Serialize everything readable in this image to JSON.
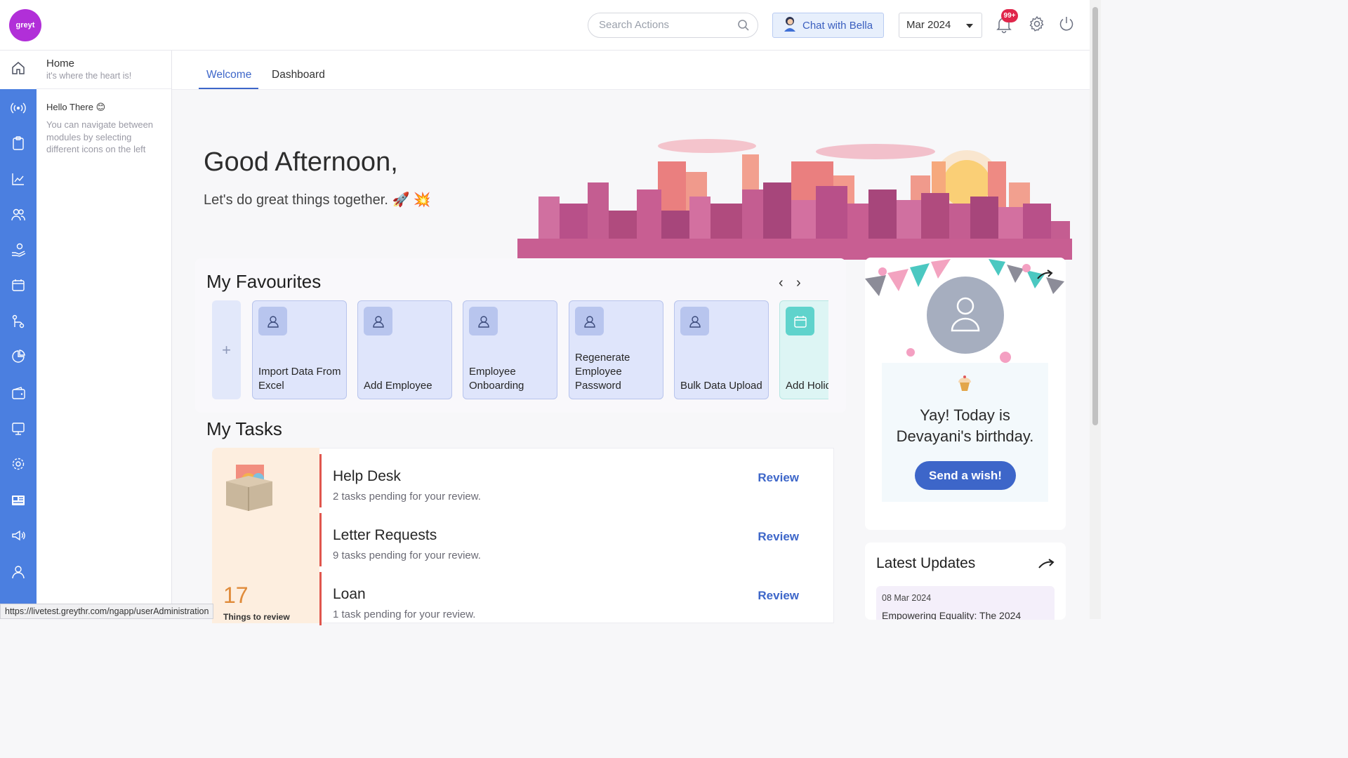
{
  "header": {
    "logo_text": "greyt",
    "search_placeholder": "Search Actions",
    "chat_label": "Chat with Bella",
    "month": "Mar 2024",
    "notification_badge": "99+"
  },
  "subpanel": {
    "title": "Home",
    "subtitle": "it's where the heart is!",
    "hello": "Hello There 😊",
    "hint": "You can navigate between modules by selecting different icons on the left"
  },
  "tabs": [
    {
      "label": "Welcome",
      "active": true
    },
    {
      "label": "Dashboard",
      "active": false
    }
  ],
  "greeting": {
    "title": "Good Afternoon,",
    "subtitle": "Let's do great things together. 🚀 💥"
  },
  "favourites": {
    "title": "My Favourites",
    "add_symbol": "+",
    "items": [
      {
        "label": "Import Data From Excel",
        "icon": "user-icon"
      },
      {
        "label": "Add Employee",
        "icon": "user-icon"
      },
      {
        "label": "Employee Onboarding",
        "icon": "user-icon"
      },
      {
        "label": "Regenerate Employee Password",
        "icon": "user-icon"
      },
      {
        "label": "Bulk Data Upload",
        "icon": "user-icon"
      },
      {
        "label": "Add Holid",
        "icon": "calendar-icon"
      }
    ]
  },
  "tasks": {
    "title": "My Tasks",
    "count": "17",
    "count_label": "Things to review",
    "items": [
      {
        "title": "Help Desk",
        "desc": "2 tasks pending for your review.",
        "action": "Review"
      },
      {
        "title": "Letter Requests",
        "desc": "9 tasks pending for your review.",
        "action": "Review"
      },
      {
        "title": "Loan",
        "desc": "1 task pending for your review.",
        "action": "Review"
      }
    ]
  },
  "birthday": {
    "message": "Yay! Today is Devayani's birthday.",
    "button": "Send a wish!"
  },
  "updates": {
    "title": "Latest Updates",
    "date": "08 Mar 2024",
    "headline": "Empowering Equality: The 2024"
  },
  "status_url": "https://livetest.greythr.com/ngapp/userAdministration",
  "colors": {
    "accent": "#3d66c9",
    "sidebar": "#4b7fe0",
    "task_bar": "#e0564d",
    "tasks_count": "#e08b3a",
    "badge": "#e0264b"
  }
}
